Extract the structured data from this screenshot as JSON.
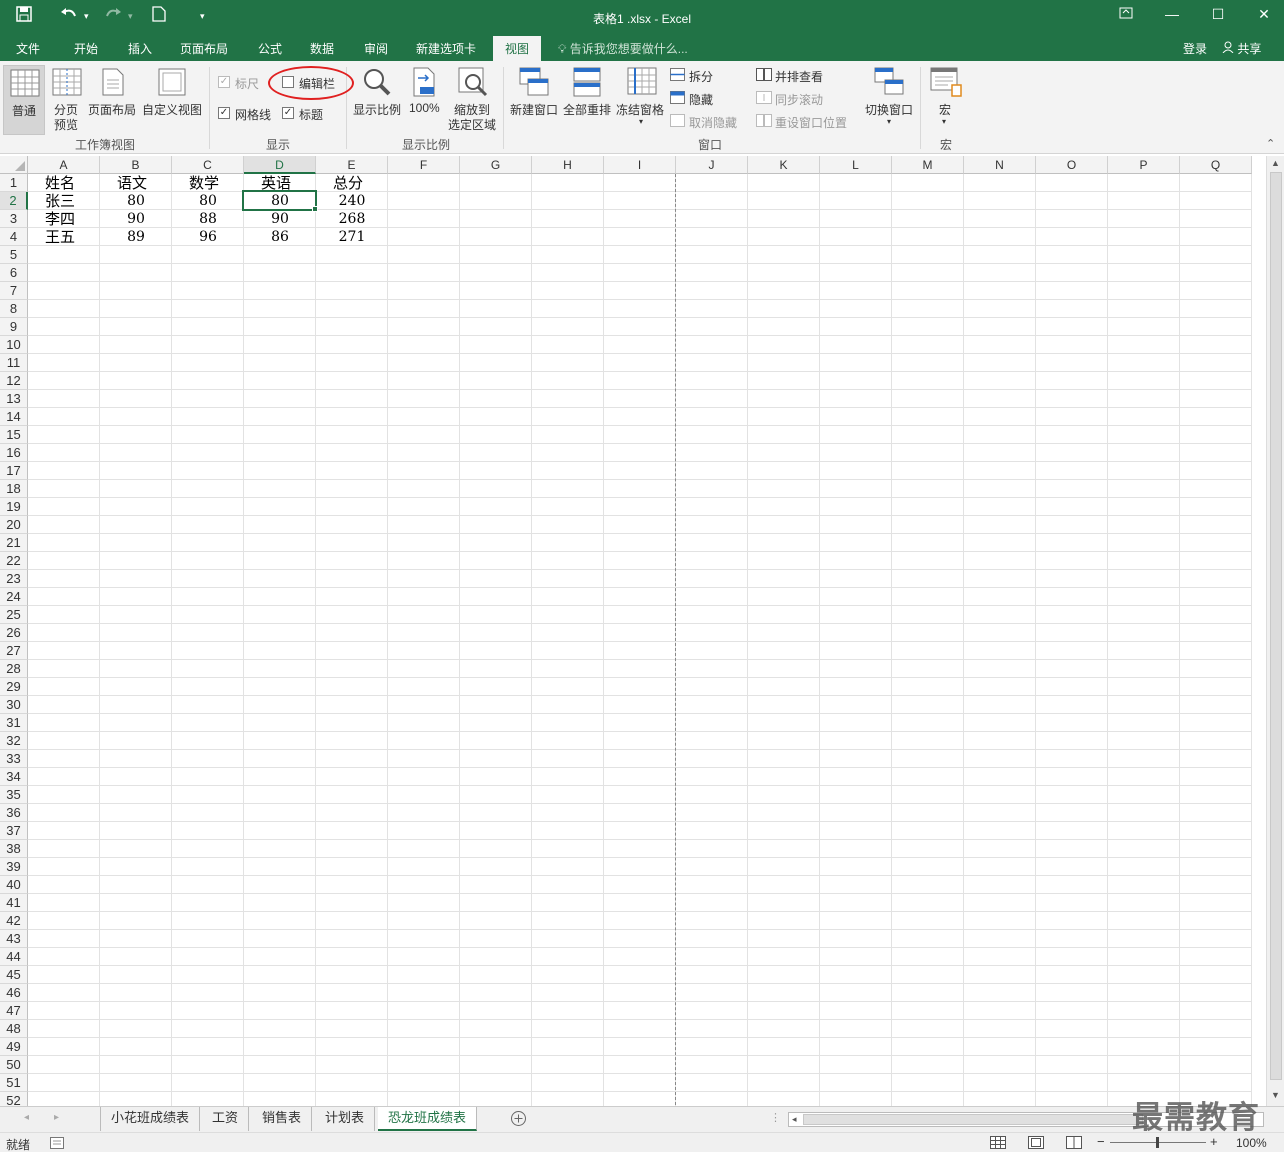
{
  "window": {
    "title": "表格1 .xlsx - Excel",
    "account": "登录",
    "share": "共享"
  },
  "ribbon_tabs": [
    "文件",
    "开始",
    "插入",
    "页面布局",
    "公式",
    "数据",
    "审阅",
    "新建选项卡",
    "视图"
  ],
  "active_tab": "视图",
  "tell_me": "告诉我您想要做什么...",
  "ribbon": {
    "workbook_views": {
      "group_label": "工作簿视图",
      "normal": "普通",
      "page_break_1": "分页",
      "page_break_2": "预览",
      "page_layout": "页面布局",
      "custom_views": "自定义视图"
    },
    "show": {
      "group_label": "显示",
      "ruler": "标尺",
      "formula_bar": "编辑栏",
      "gridlines": "网格线",
      "headings": "标题",
      "ruler_checked": true,
      "formula_bar_checked": false,
      "gridlines_checked": true,
      "headings_checked": true
    },
    "zoom": {
      "group_label": "显示比例",
      "zoom": "显示比例",
      "hundred": "100%",
      "zoom_to_sel_1": "缩放到",
      "zoom_to_sel_2": "选定区域"
    },
    "window": {
      "group_label": "窗口",
      "new_window": "新建窗口",
      "arrange_all": "全部重排",
      "freeze_panes": "冻结窗格",
      "split": "拆分",
      "hide": "隐藏",
      "unhide": "取消隐藏",
      "side_by_side": "并排查看",
      "sync_scroll": "同步滚动",
      "reset_position": "重设窗口位置",
      "switch_windows": "切换窗口"
    },
    "macros": {
      "group_label": "宏",
      "macros": "宏"
    }
  },
  "columns": [
    "A",
    "B",
    "C",
    "D",
    "E",
    "F",
    "G",
    "H",
    "I",
    "J",
    "K",
    "L",
    "M",
    "N",
    "O",
    "P",
    "Q"
  ],
  "selected_column": "D",
  "selected_row": 2,
  "row_count": 52,
  "table": {
    "headers": [
      "姓名",
      "语文",
      "数学",
      "英语",
      "总分"
    ],
    "rows": [
      [
        "张三",
        "80",
        "80",
        "80",
        "240"
      ],
      [
        "李四",
        "90",
        "88",
        "90",
        "268"
      ],
      [
        "王五",
        "89",
        "96",
        "86",
        "271"
      ]
    ]
  },
  "sheets": [
    "小花班成绩表",
    "工资",
    "销售表",
    "计划表",
    "恐龙班成绩表"
  ],
  "active_sheet": "恐龙班成绩表",
  "status": {
    "ready": "就绪",
    "zoom": "100%"
  },
  "watermark": "最需教育",
  "colors": {
    "excel_green": "#217346",
    "annotation_red": "#e02020"
  }
}
